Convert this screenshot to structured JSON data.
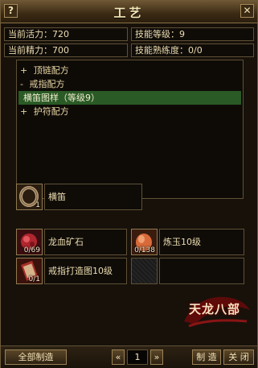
{
  "window": {
    "title": "工艺",
    "help_label": "?",
    "close_label": "✕"
  },
  "stats": {
    "vitality": "当前活力：720",
    "skill_level": "技能等级：9",
    "energy": "当前精力：700",
    "proficiency": "技能熟练度：0/0"
  },
  "recipe_tree": {
    "categories": [
      {
        "toggle": "+",
        "label": "顶链配方"
      },
      {
        "toggle": "-",
        "label": "戒指配方"
      },
      {
        "toggle": "+",
        "label": "护符配方"
      }
    ],
    "selected_recipe": "横笛图样（等级9）"
  },
  "product": {
    "count": "1",
    "name": "横笛",
    "icon": "ring-icon"
  },
  "materials": [
    {
      "count": "0/69",
      "name": "龙血矿石",
      "icon": "ore-icon"
    },
    {
      "count": "0/138",
      "name": "炼玉10级",
      "icon": "jade-icon"
    },
    {
      "count": "0/1",
      "name": "戒指打造图10级",
      "icon": "scroll-icon"
    },
    {
      "count": "",
      "name": "",
      "icon": ""
    }
  ],
  "logo": {
    "text": "天龙八部"
  },
  "footer": {
    "craft_all_label": "全部制造",
    "prev_label": "«",
    "quantity": "1",
    "next_label": "»",
    "craft_label": "制 造",
    "close_label": "关 闭"
  },
  "colors": {
    "selection_bg": "#2a5a26",
    "gold_text": "#e6d2a2",
    "border": "#8f7a52"
  }
}
